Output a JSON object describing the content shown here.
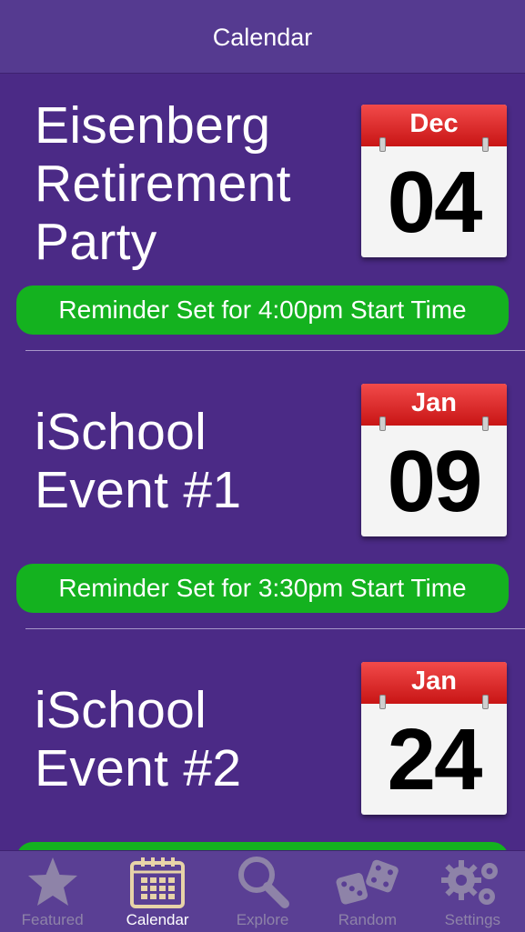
{
  "header": {
    "title": "Calendar"
  },
  "events": [
    {
      "title_lines": [
        "Eisenberg",
        "Retirement",
        "Party"
      ],
      "month": "Dec",
      "day": "04",
      "reminder": "Reminder Set for 4:00pm Start Time"
    },
    {
      "title_lines": [
        "iSchool",
        "Event #1"
      ],
      "month": "Jan",
      "day": "09",
      "reminder": "Reminder Set for 3:30pm Start Time"
    },
    {
      "title_lines": [
        "iSchool",
        "Event #2"
      ],
      "month": "Jan",
      "day": "24",
      "reminder": ""
    }
  ],
  "tabs": [
    {
      "label": "Featured",
      "icon": "star-icon",
      "active": false
    },
    {
      "label": "Calendar",
      "icon": "calendar-icon",
      "active": true
    },
    {
      "label": "Explore",
      "icon": "magnifier-icon",
      "active": false
    },
    {
      "label": "Random",
      "icon": "dice-icon",
      "active": false
    },
    {
      "label": "Settings",
      "icon": "gears-icon",
      "active": false
    }
  ],
  "colors": {
    "background": "#4b2a86",
    "navbar": "#553a90",
    "reminder_green": "#14b21f",
    "calendar_red": "#d92020",
    "tab_inactive": "#8e83a8",
    "tab_active_icon": "#e7d3a8"
  }
}
